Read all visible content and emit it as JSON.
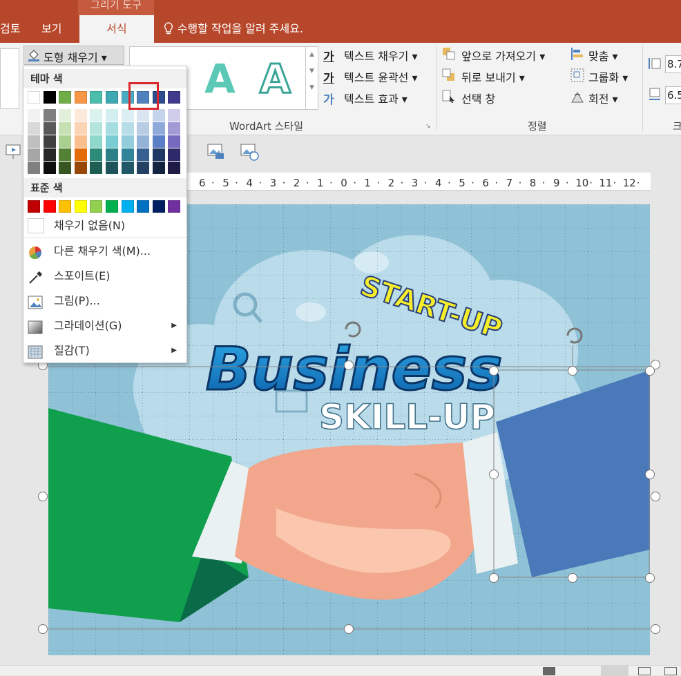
{
  "titlebar": {
    "context_label": "그리기 도구"
  },
  "tabs": [
    {
      "label": "검토"
    },
    {
      "label": "보기"
    },
    {
      "label": "서식"
    }
  ],
  "tell_me": {
    "placeholder": "수행할 작업을 알려 주세요."
  },
  "ribbon": {
    "shape_fill": "도형 채우기 ▾",
    "wordart": {
      "letters": [
        "A",
        "A"
      ],
      "group_label": "WordArt 스타일",
      "text_fill": "텍스트 채우기 ▾",
      "text_outline": "텍스트 윤곽선 ▾",
      "text_effects": "텍스트 효과 ▾",
      "glyph": "가"
    },
    "arrange": {
      "group_label": "정렬",
      "bring_forward": "앞으로 가져오기 ▾",
      "send_backward": "뒤로 보내기 ▾",
      "selection_pane": "선택 창",
      "align": "맞춤 ▾",
      "group": "그룹화 ▾",
      "rotate": "회전 ▾"
    },
    "size": {
      "height": "8.7",
      "width": "6.5",
      "group_label": "크"
    }
  },
  "ruler": {
    "ticks": [
      "6",
      "5",
      "4",
      "3",
      "2",
      "1",
      "0",
      "1",
      "2",
      "3",
      "4",
      "5",
      "6",
      "7",
      "8",
      "9",
      "10",
      "11",
      "12"
    ]
  },
  "slide": {
    "start_up": "START-UP",
    "business": "Business",
    "skill_up": "SKILL-UP"
  },
  "colors": {
    "accent": "#b7472a",
    "selection": "#d9262b"
  },
  "fill_menu": {
    "theme_header": "테마 색",
    "standard_header": "표준 색",
    "theme_row": [
      "#ffffff",
      "#000000",
      "#70ad47",
      "#f79646",
      "#4bbfac",
      "#3fa9b3",
      "#4bacc6",
      "#4f81bd",
      "#2e4e8f",
      "#403a8c"
    ],
    "shade_rows": [
      [
        "#f2f2f2",
        "#7f7f7f",
        "#e2efda",
        "#fde9d9",
        "#d9f2ee",
        "#d2eef0",
        "#daeef3",
        "#dbe5f1",
        "#c6d3ec",
        "#d0cdea"
      ],
      [
        "#d9d9d9",
        "#595959",
        "#c6e0b4",
        "#fbd4b4",
        "#b4e5dd",
        "#a6dde1",
        "#b6dde8",
        "#b8cce4",
        "#8eaadb",
        "#a29ad5"
      ],
      [
        "#bfbfbf",
        "#404040",
        "#a9d08e",
        "#f9bf8f",
        "#8ed8cc",
        "#79ccd2",
        "#92cddc",
        "#95b3d7",
        "#5b7fc7",
        "#766ac0"
      ],
      [
        "#a6a6a6",
        "#262626",
        "#548235",
        "#e36c09",
        "#2e8b7a",
        "#2b7f86",
        "#31859b",
        "#366092",
        "#203864",
        "#2e2a69"
      ],
      [
        "#808080",
        "#0d0d0d",
        "#375623",
        "#974806",
        "#1e5d51",
        "#1c5459",
        "#205867",
        "#244062",
        "#14233f",
        "#1e1b46"
      ]
    ],
    "standard_row": [
      "#c00000",
      "#ff0000",
      "#ffc000",
      "#ffff00",
      "#92d050",
      "#00b050",
      "#00b0f0",
      "#0070c0",
      "#002060",
      "#7030a0"
    ],
    "items": [
      {
        "label": "채우기 없음(N)"
      },
      {
        "label": "다른 채우기 색(M)...",
        "icon": "color-wheel-icon"
      },
      {
        "label": "스포이트(E)",
        "icon": "eyedropper-icon"
      },
      {
        "label": "그림(P)...",
        "icon": "picture-icon"
      },
      {
        "label": "그라데이션(G)",
        "icon": "gradient-icon",
        "submenu": "▶"
      },
      {
        "label": "질감(T)",
        "icon": "texture-icon",
        "submenu": "▶"
      }
    ]
  }
}
